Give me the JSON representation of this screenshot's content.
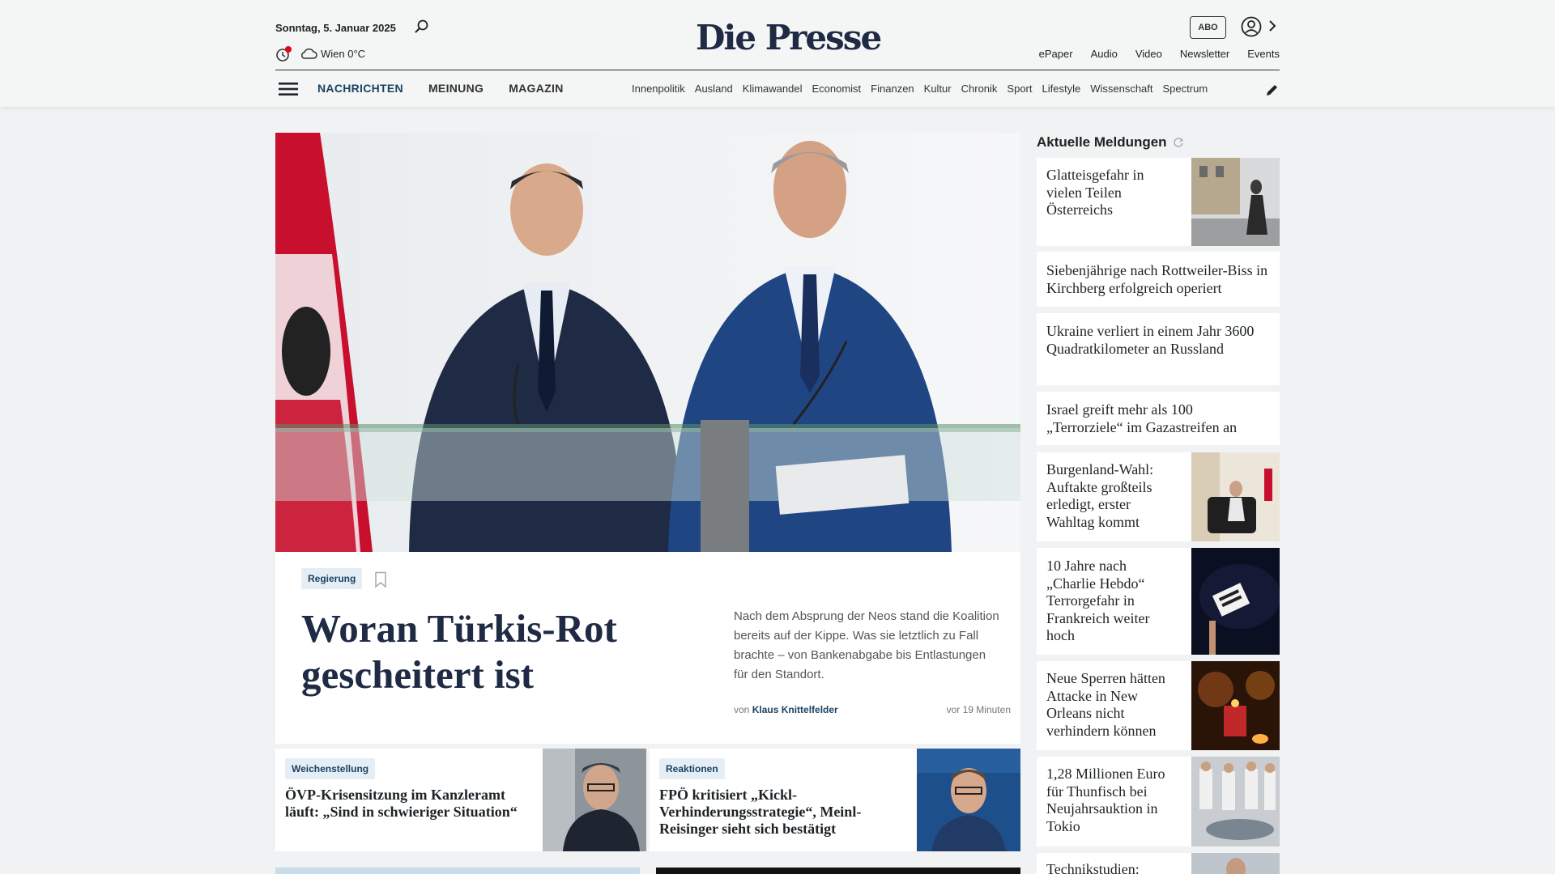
{
  "header": {
    "date": "Sonntag, 5. Januar 2025",
    "weather": "Wien 0°C",
    "logo": "Die Presse",
    "abo_label": "ABO",
    "top_links": [
      "ePaper",
      "Audio",
      "Video",
      "Newsletter",
      "Events"
    ],
    "main_nav": [
      "NACHRICHTEN",
      "MEINUNG",
      "MAGAZIN"
    ],
    "active_main_nav": "NACHRICHTEN",
    "sub_nav": [
      "Innenpolitik",
      "Ausland",
      "Klimawandel",
      "Economist",
      "Finanzen",
      "Kultur",
      "Chronik",
      "Sport",
      "Lifestyle",
      "Wissenschaft",
      "Spectrum"
    ]
  },
  "hero": {
    "tag": "Regierung",
    "title": "Woran Türkis-Rot gescheitert ist",
    "teaser": "Nach dem Absprung der Neos stand die Koalition bereits auf der Kippe. Was sie letztlich zu Fall brachte – von Bankenabgabe bis Entlastungen für den Standort.",
    "byline_prefix": "von",
    "author": "Klaus Knittelfelder",
    "time": "vor 19 Minuten"
  },
  "cards": [
    {
      "tag": "Weichenstellung",
      "title": "ÖVP-Krisensitzung im Kanzleramt läuft: „Sind in schwieriger Situation“"
    },
    {
      "tag": "Reaktionen",
      "title": "FPÖ kritisiert „Kickl-Verhinderungsstrategie“, Meinl-Reisinger sieht sich bestätigt"
    }
  ],
  "sidebar": {
    "title": "Aktuelle Meldungen",
    "items": [
      {
        "title": "Glatteisgefahr in vielen Teilen Österreichs",
        "has_image": true
      },
      {
        "title": "Siebenjährige nach Rottweiler-Biss in Kirchberg erfolgreich operiert",
        "has_image": false
      },
      {
        "title": "Ukraine verliert in einem Jahr 3600 Quadratkilometer an Russland",
        "has_image": false
      },
      {
        "title": "Israel greift mehr als 100 „Terrorziele“ im Gazastreifen an",
        "has_image": false
      },
      {
        "title": "Burgenland-Wahl: Auftakte großteils erledigt, erster Wahltag kommt",
        "has_image": true
      },
      {
        "title": "10 Jahre nach „Charlie Hebdo“ Terrorgefahr in Frankreich weiter hoch",
        "has_image": true
      },
      {
        "title": "Neue Sperren hätten Attacke in New Orleans nicht verhindern können",
        "has_image": true
      },
      {
        "title": "1,28 Millionen Euro für Thunfisch bei Neujahrsauktion in Tokio",
        "has_image": true
      },
      {
        "title": "Technikstudien:",
        "has_image": true
      }
    ]
  },
  "colors": {
    "brand_navy": "#1f2a44",
    "link_blue": "#1b4263",
    "tag_bg": "#e6eef5",
    "page_bg": "#f1f2f3"
  }
}
